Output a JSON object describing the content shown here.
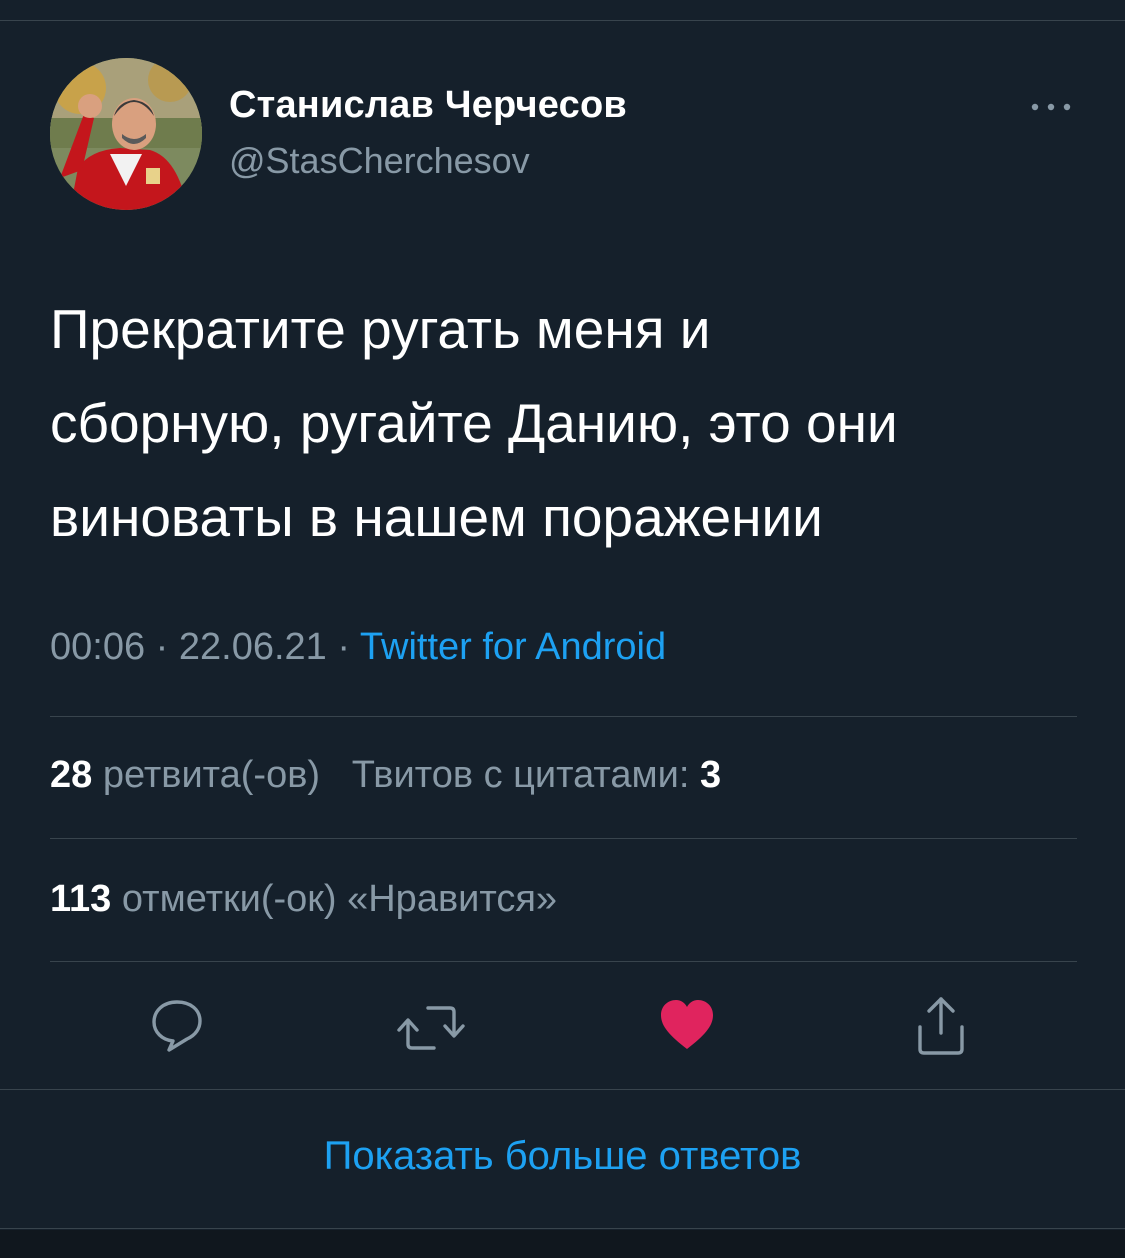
{
  "author": {
    "display_name": "Станислав Черчесов",
    "handle": "@StasCherchesov",
    "avatar_icon": "profile-photo"
  },
  "tweet": {
    "lines": [
      "Прекратите ругать меня и",
      "сборную, ругайте Данию, это они",
      "виноваты в нашем поражении"
    ],
    "time": "00:06",
    "separator": " · ",
    "date": "22.06.21",
    "source": "Twitter for Android"
  },
  "stats": {
    "retweets_count": "28",
    "retweets_label": "ретвита(-ов)",
    "quotes_label": "Твитов с цитатами:",
    "quotes_count": "3",
    "likes_count": "113",
    "likes_label": "отметки(-ок) «Нравится»"
  },
  "actions": {
    "reply_icon": "speech-bubble-icon",
    "retweet_icon": "retweet-icon",
    "like_icon": "heart-icon",
    "share_icon": "share-icon",
    "liked": true
  },
  "footer": {
    "show_more": "Показать больше ответов"
  },
  "colors": {
    "background": "#15202b",
    "text_primary": "#ffffff",
    "text_secondary": "#8899a6",
    "link": "#1da1f2",
    "like": "#e0245e",
    "divider": "#38444d"
  }
}
